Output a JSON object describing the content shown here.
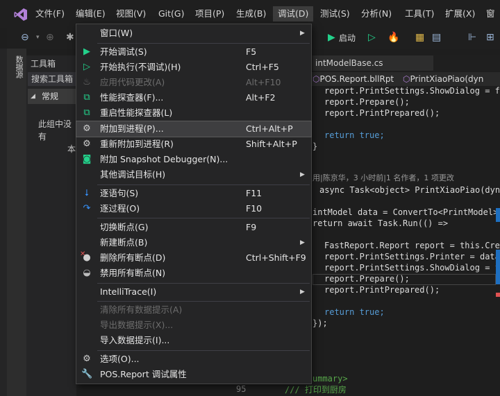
{
  "menubar": {
    "items": [
      "文件(F)",
      "编辑(E)",
      "视图(V)",
      "Git(G)",
      "项目(P)",
      "生成(B)",
      "调试(D)",
      "测试(S)",
      "分析(N)",
      "工具(T)",
      "扩展(X)",
      "窗"
    ]
  },
  "toolbar": {
    "start_label": "启动"
  },
  "side_tab": {
    "label": "数据源"
  },
  "toolbox": {
    "title": "工具箱",
    "search_placeholder": "搜索工具箱",
    "group": "常规",
    "empty_text": "此组中没有可用的控件。将某项拖至此文本可将其添加到工具箱。",
    "empty_text_visible_1": "此组中没有",
    "empty_text_visible_2": "本"
  },
  "editor": {
    "file_tab": "intModelBase.cs",
    "nav_left": "POS.Report.bllRpt",
    "nav_right": "PrintXiaoPiao(dyn",
    "codelens": "用|陈京华，3 小时前|1 名作者，1 项更改",
    "line_number": "95",
    "lines": {
      "l1": "report.PrintSettings.ShowDialog = fa",
      "l2": "report.Prepare();",
      "l3": "report.PrintPrepared();",
      "l4": "return true;",
      "l5": "}",
      "l6": "async Task<object> PrintXiaoPiao(dyn",
      "l7": "intModel data = ConvertTo<PrintModel>",
      "l8": "return await Task.Run(() =>",
      "l9": "FastReport.Report report = this.Cre",
      "l10": "report.PrintSettings.Printer = data",
      "l11": "report.PrintSettings.ShowDialog = fa",
      "l12": "report.Prepare();",
      "l13": "report.PrintPrepared();",
      "l14": "return true;",
      "l15": "});",
      "l16": "ummary>",
      "l17": "/// 打印到厨房"
    }
  },
  "debug_menu": {
    "items": [
      {
        "label": "窗口(W)",
        "shortcut": "",
        "icon": "",
        "submenu": true
      },
      {
        "label": "开始调试(S)",
        "shortcut": "F5",
        "icon": "play-icon"
      },
      {
        "label": "开始执行(不调试)(H)",
        "shortcut": "Ctrl+F5",
        "icon": "play-outline-icon"
      },
      {
        "label": "应用代码更改(A)",
        "shortcut": "Alt+F10",
        "icon": "hot-reload-icon",
        "disabled": true
      },
      {
        "label": "性能探查器(F)...",
        "shortcut": "Alt+F2",
        "icon": "profiler-icon"
      },
      {
        "label": "重启性能探查器(L)",
        "shortcut": "",
        "icon": "profiler-restart-icon"
      },
      {
        "label": "附加到进程(P)...",
        "shortcut": "Ctrl+Alt+P",
        "icon": "attach-icon",
        "hover": true
      },
      {
        "label": "重新附加到进程(R)",
        "shortcut": "Shift+Alt+P",
        "icon": "reattach-icon"
      },
      {
        "label": "附加 Snapshot Debugger(N)...",
        "shortcut": "",
        "icon": "camera-icon"
      },
      {
        "label": "其他调试目标(H)",
        "shortcut": "",
        "submenu": true
      },
      {
        "label": "逐语句(S)",
        "shortcut": "F11",
        "icon": "step-into-icon"
      },
      {
        "label": "逐过程(O)",
        "shortcut": "F10",
        "icon": "step-over-icon"
      },
      {
        "label": "切换断点(G)",
        "shortcut": "F9"
      },
      {
        "label": "新建断点(B)",
        "shortcut": "",
        "submenu": true
      },
      {
        "label": "删除所有断点(D)",
        "shortcut": "Ctrl+Shift+F9",
        "icon": "delete-breakpoints-icon"
      },
      {
        "label": "禁用所有断点(N)",
        "shortcut": "",
        "icon": "disable-breakpoints-icon"
      },
      {
        "label": "IntelliTrace(I)",
        "shortcut": "",
        "submenu": true
      },
      {
        "label": "清除所有数据提示(A)",
        "shortcut": "",
        "disabled": true
      },
      {
        "label": "导出数据提示(X)...",
        "shortcut": "",
        "disabled": true
      },
      {
        "label": "导入数据提示(I)...",
        "shortcut": ""
      },
      {
        "label": "选项(O)...",
        "shortcut": "",
        "icon": "gear-icon"
      },
      {
        "label": "POS.Report 调试属性",
        "shortcut": "",
        "icon": "wrench-icon"
      }
    ]
  }
}
